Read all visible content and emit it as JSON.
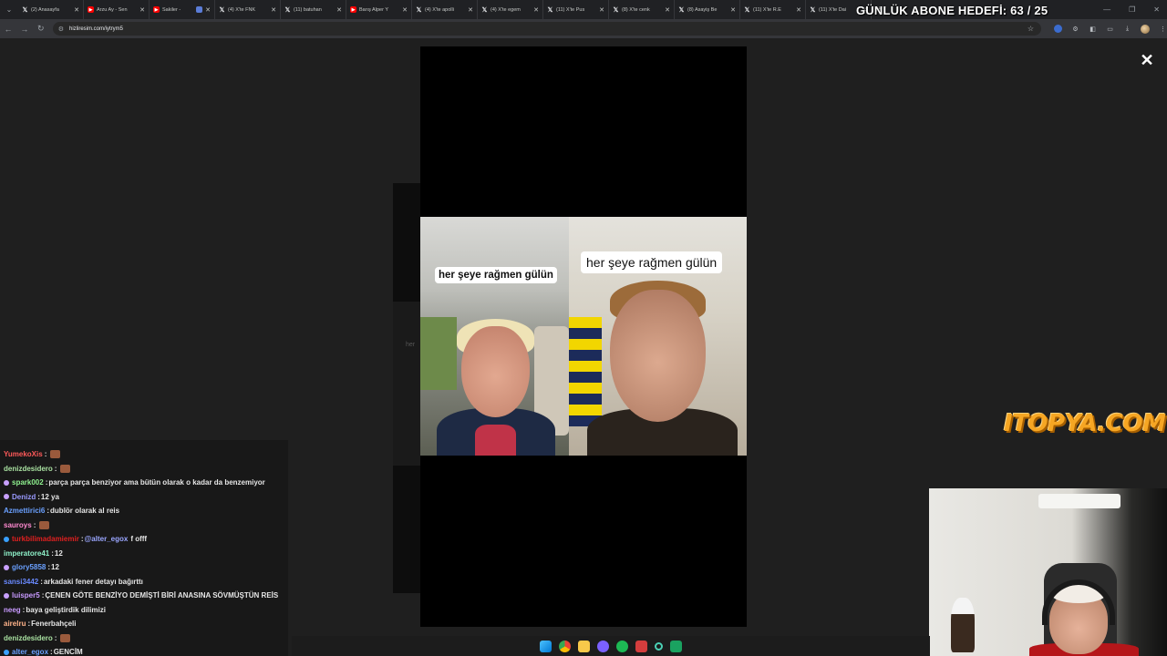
{
  "browser": {
    "tabs": [
      {
        "label": "(2) Anasayfa",
        "icon": "x-icon",
        "type": "x"
      },
      {
        "label": "Arzu Ay - Sen",
        "icon": "youtube-icon",
        "type": "yt"
      },
      {
        "label": "Sakiler -",
        "icon": "youtube-icon",
        "type": "yt"
      },
      {
        "label": "(4) X'te FNK",
        "icon": "x-icon",
        "type": "x"
      },
      {
        "label": "(11) batuhan",
        "icon": "x-icon",
        "type": "x"
      },
      {
        "label": "Barış Alper Y",
        "icon": "youtube-icon",
        "type": "yt"
      },
      {
        "label": "(4) X'te apolli",
        "icon": "x-icon",
        "type": "x"
      },
      {
        "label": "(4) X'te egem",
        "icon": "x-icon",
        "type": "x"
      },
      {
        "label": "(11) X'te Pus",
        "icon": "x-icon",
        "type": "x"
      },
      {
        "label": "(8) X'te cenk",
        "icon": "x-icon",
        "type": "x"
      },
      {
        "label": "(8) Asayiş Be",
        "icon": "x-icon",
        "type": "x"
      },
      {
        "label": "(11) X'te R.E",
        "icon": "x-icon",
        "type": "x"
      },
      {
        "label": "(11) X'te Dai",
        "icon": "x-icon",
        "type": "x"
      }
    ],
    "mail_tab_icon": "mail-icon",
    "url": "hizliresim.com/iytrym5"
  },
  "overlay": {
    "sub_goal": "GÜNLÜK ABONE HEDEFİ: 63 / 25",
    "close_symbol": "✕",
    "sponsor_logo_text": "ITOPYA.COM"
  },
  "clip": {
    "caption_left": "her şeye rağmen gülün",
    "caption_right": "her şeye rağmen gülün"
  },
  "chat": {
    "messages": [
      {
        "user": "YumekoXis",
        "user_color": "#ff5a5a",
        "text": "",
        "emote": true,
        "badge": ""
      },
      {
        "user": "denizdesidero",
        "user_color": "#a8e0a0",
        "text": "",
        "emote": true,
        "badge": ""
      },
      {
        "user": "spark002",
        "user_color": "#8ef08e",
        "text": "parça parça benziyor ama bütün olarak o kadar da benzemiyor",
        "emote": false,
        "badge": "#c9a0ff"
      },
      {
        "user": "Denizd",
        "user_color": "#9a9aff",
        "text": "12 ya",
        "emote": false,
        "badge": "#c9a0ff"
      },
      {
        "user": "Azmettirici6",
        "user_color": "#6aa0ff",
        "text": "dublör olarak al reis",
        "emote": false,
        "badge": ""
      },
      {
        "user": "sauroys",
        "user_color": "#ff8ad0",
        "text": "",
        "emote": true,
        "badge": ""
      },
      {
        "user": "turkbilimadamiemir",
        "user_color": "#e02020",
        "text": "f offf",
        "mention": "@alter_egox",
        "emote": false,
        "badge": "#39a0ff"
      },
      {
        "user": "imperatore41",
        "user_color": "#8ef0c8",
        "text": "12",
        "emote": false,
        "badge": ""
      },
      {
        "user": "glory5858",
        "user_color": "#6aa0ff",
        "text": "12",
        "emote": false,
        "badge": "#c9a0ff"
      },
      {
        "user": "sansi3442",
        "user_color": "#6a8aff",
        "text": "arkadaki fener detayı bağırttı",
        "emote": false,
        "badge": ""
      },
      {
        "user": "luisper5",
        "user_color": "#c89aff",
        "text": "ÇENEN GÖTE BENZİYO DEMİŞTİ BİRİ ANASINA SÖVMÜŞTÜN REİS",
        "emote": false,
        "badge": "#c9a0ff"
      },
      {
        "user": "neeg",
        "user_color": "#c89aff",
        "text": "baya geliştirdik dilimizi",
        "emote": false,
        "badge": ""
      },
      {
        "user": "airelru",
        "user_color": "#ffb38a",
        "text": "Fenerbahçeli",
        "emote": false,
        "badge": ""
      },
      {
        "user": "denizdesidero",
        "user_color": "#a8e0a0",
        "text": "",
        "emote": true,
        "badge": ""
      },
      {
        "user": "alter_egox",
        "user_color": "#6aa0ff",
        "text": "GENCİM",
        "emote": false,
        "badge": "#39a0ff"
      }
    ]
  },
  "taskbar": {
    "icons": [
      "windows-start-icon",
      "chrome-icon",
      "file-explorer-icon",
      "discord-icon",
      "spotify-icon",
      "x-app-icon",
      "obs-icon",
      "green-app-icon"
    ]
  }
}
